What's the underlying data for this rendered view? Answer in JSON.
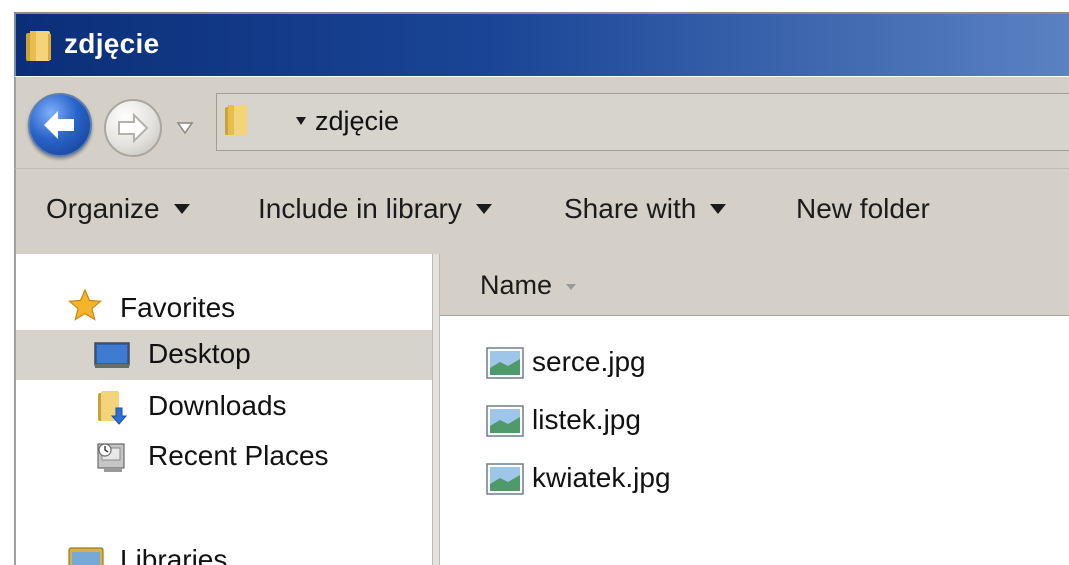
{
  "window": {
    "title": "zdjęcie"
  },
  "address_bar": {
    "path": "zdjęcie"
  },
  "toolbar": {
    "organize": "Organize",
    "include_in_library": "Include in library",
    "share_with": "Share with",
    "new_folder": "New folder"
  },
  "navigation_pane": {
    "favorites_label": "Favorites",
    "items": [
      {
        "label": "Desktop",
        "icon": "desktop-icon",
        "selected": true
      },
      {
        "label": "Downloads",
        "icon": "downloads-folder-icon",
        "selected": false
      },
      {
        "label": "Recent Places",
        "icon": "recent-places-icon",
        "selected": false
      }
    ],
    "libraries_label": "Libraries"
  },
  "file_list": {
    "column_name": "Name",
    "files": [
      {
        "name": "serce.jpg",
        "icon": "image-file-icon"
      },
      {
        "name": "listek.jpg",
        "icon": "image-file-icon"
      },
      {
        "name": "kwiatek.jpg",
        "icon": "image-file-icon"
      }
    ]
  },
  "colors": {
    "titlebar_start": "#0b2e78",
    "titlebar_end": "#5a82c2",
    "chrome_gray": "#d4d0c8",
    "selection_gray": "#d6d3cc"
  }
}
